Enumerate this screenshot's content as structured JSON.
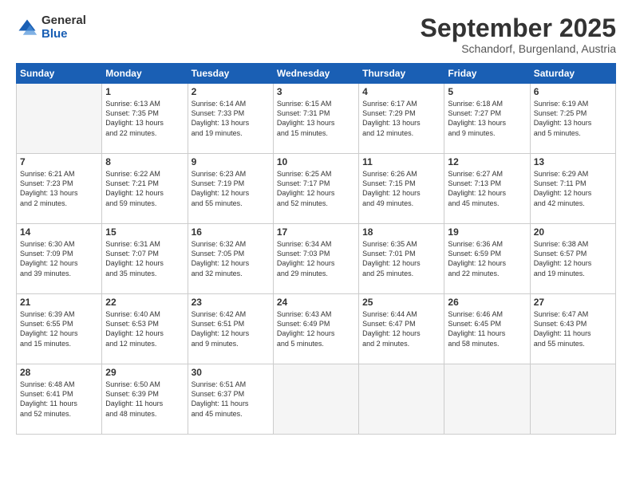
{
  "logo": {
    "general": "General",
    "blue": "Blue"
  },
  "title": "September 2025",
  "location": "Schandorf, Burgenland, Austria",
  "days_of_week": [
    "Sunday",
    "Monday",
    "Tuesday",
    "Wednesday",
    "Thursday",
    "Friday",
    "Saturday"
  ],
  "weeks": [
    [
      {
        "day": "",
        "info": ""
      },
      {
        "day": "1",
        "info": "Sunrise: 6:13 AM\nSunset: 7:35 PM\nDaylight: 13 hours\nand 22 minutes."
      },
      {
        "day": "2",
        "info": "Sunrise: 6:14 AM\nSunset: 7:33 PM\nDaylight: 13 hours\nand 19 minutes."
      },
      {
        "day": "3",
        "info": "Sunrise: 6:15 AM\nSunset: 7:31 PM\nDaylight: 13 hours\nand 15 minutes."
      },
      {
        "day": "4",
        "info": "Sunrise: 6:17 AM\nSunset: 7:29 PM\nDaylight: 13 hours\nand 12 minutes."
      },
      {
        "day": "5",
        "info": "Sunrise: 6:18 AM\nSunset: 7:27 PM\nDaylight: 13 hours\nand 9 minutes."
      },
      {
        "day": "6",
        "info": "Sunrise: 6:19 AM\nSunset: 7:25 PM\nDaylight: 13 hours\nand 5 minutes."
      }
    ],
    [
      {
        "day": "7",
        "info": "Sunrise: 6:21 AM\nSunset: 7:23 PM\nDaylight: 13 hours\nand 2 minutes."
      },
      {
        "day": "8",
        "info": "Sunrise: 6:22 AM\nSunset: 7:21 PM\nDaylight: 12 hours\nand 59 minutes."
      },
      {
        "day": "9",
        "info": "Sunrise: 6:23 AM\nSunset: 7:19 PM\nDaylight: 12 hours\nand 55 minutes."
      },
      {
        "day": "10",
        "info": "Sunrise: 6:25 AM\nSunset: 7:17 PM\nDaylight: 12 hours\nand 52 minutes."
      },
      {
        "day": "11",
        "info": "Sunrise: 6:26 AM\nSunset: 7:15 PM\nDaylight: 12 hours\nand 49 minutes."
      },
      {
        "day": "12",
        "info": "Sunrise: 6:27 AM\nSunset: 7:13 PM\nDaylight: 12 hours\nand 45 minutes."
      },
      {
        "day": "13",
        "info": "Sunrise: 6:29 AM\nSunset: 7:11 PM\nDaylight: 12 hours\nand 42 minutes."
      }
    ],
    [
      {
        "day": "14",
        "info": "Sunrise: 6:30 AM\nSunset: 7:09 PM\nDaylight: 12 hours\nand 39 minutes."
      },
      {
        "day": "15",
        "info": "Sunrise: 6:31 AM\nSunset: 7:07 PM\nDaylight: 12 hours\nand 35 minutes."
      },
      {
        "day": "16",
        "info": "Sunrise: 6:32 AM\nSunset: 7:05 PM\nDaylight: 12 hours\nand 32 minutes."
      },
      {
        "day": "17",
        "info": "Sunrise: 6:34 AM\nSunset: 7:03 PM\nDaylight: 12 hours\nand 29 minutes."
      },
      {
        "day": "18",
        "info": "Sunrise: 6:35 AM\nSunset: 7:01 PM\nDaylight: 12 hours\nand 25 minutes."
      },
      {
        "day": "19",
        "info": "Sunrise: 6:36 AM\nSunset: 6:59 PM\nDaylight: 12 hours\nand 22 minutes."
      },
      {
        "day": "20",
        "info": "Sunrise: 6:38 AM\nSunset: 6:57 PM\nDaylight: 12 hours\nand 19 minutes."
      }
    ],
    [
      {
        "day": "21",
        "info": "Sunrise: 6:39 AM\nSunset: 6:55 PM\nDaylight: 12 hours\nand 15 minutes."
      },
      {
        "day": "22",
        "info": "Sunrise: 6:40 AM\nSunset: 6:53 PM\nDaylight: 12 hours\nand 12 minutes."
      },
      {
        "day": "23",
        "info": "Sunrise: 6:42 AM\nSunset: 6:51 PM\nDaylight: 12 hours\nand 9 minutes."
      },
      {
        "day": "24",
        "info": "Sunrise: 6:43 AM\nSunset: 6:49 PM\nDaylight: 12 hours\nand 5 minutes."
      },
      {
        "day": "25",
        "info": "Sunrise: 6:44 AM\nSunset: 6:47 PM\nDaylight: 12 hours\nand 2 minutes."
      },
      {
        "day": "26",
        "info": "Sunrise: 6:46 AM\nSunset: 6:45 PM\nDaylight: 11 hours\nand 58 minutes."
      },
      {
        "day": "27",
        "info": "Sunrise: 6:47 AM\nSunset: 6:43 PM\nDaylight: 11 hours\nand 55 minutes."
      }
    ],
    [
      {
        "day": "28",
        "info": "Sunrise: 6:48 AM\nSunset: 6:41 PM\nDaylight: 11 hours\nand 52 minutes."
      },
      {
        "day": "29",
        "info": "Sunrise: 6:50 AM\nSunset: 6:39 PM\nDaylight: 11 hours\nand 48 minutes."
      },
      {
        "day": "30",
        "info": "Sunrise: 6:51 AM\nSunset: 6:37 PM\nDaylight: 11 hours\nand 45 minutes."
      },
      {
        "day": "",
        "info": ""
      },
      {
        "day": "",
        "info": ""
      },
      {
        "day": "",
        "info": ""
      },
      {
        "day": "",
        "info": ""
      }
    ]
  ]
}
